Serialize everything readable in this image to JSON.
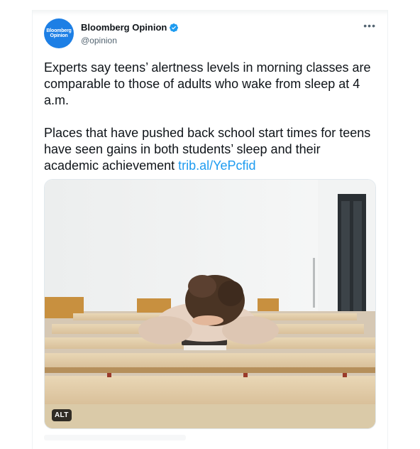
{
  "author": {
    "avatar_text": [
      "Bloomberg",
      "Opinion"
    ],
    "name": "Bloomberg Opinion",
    "handle": "@opinion",
    "verified_icon": "verified-badge-icon"
  },
  "menu": {
    "more_label": "•••"
  },
  "tweet": {
    "paragraph1": "Experts say teens’ alertness levels in morning classes are comparable to those of adults who wake from sleep at 4 a.m.",
    "paragraph2": "Places that have pushed back school start times for teens have seen gains in both students’ sleep and their academic achievement ",
    "link": "trib.al/YePcfid"
  },
  "media": {
    "alt_label": "ALT"
  },
  "colors": {
    "accent": "#1d9bf0",
    "avatar_bg": "#1d7fe5",
    "text": "#0f1419",
    "muted": "#536471"
  }
}
